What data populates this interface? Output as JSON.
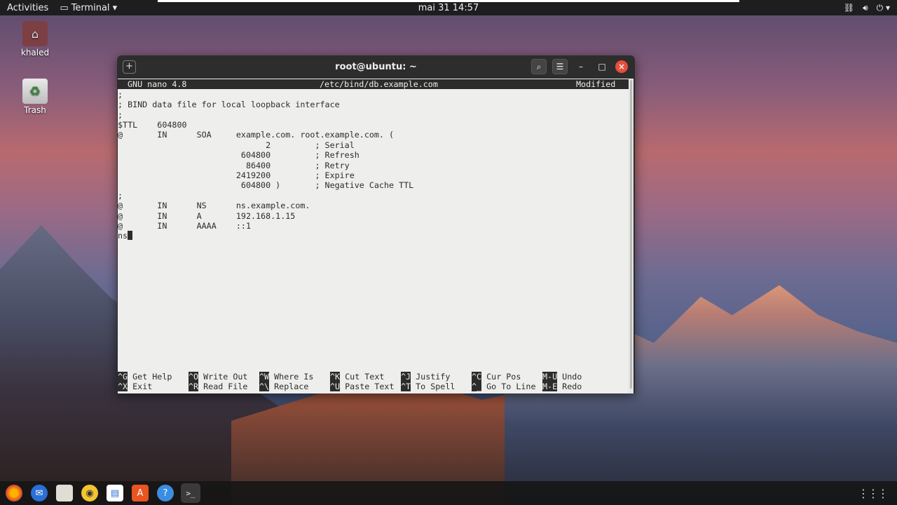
{
  "topbar": {
    "activities": "Activities",
    "app_name": "Terminal",
    "clock": "mai 31  14:57",
    "tray_icons": [
      "network-icon",
      "volume-icon",
      "power-icon"
    ]
  },
  "desktop": {
    "icons": [
      {
        "label": "khaled",
        "icon": "home-folder-icon"
      },
      {
        "label": "Trash",
        "icon": "trash-icon"
      }
    ]
  },
  "terminal": {
    "title": "root@ubuntu: ~",
    "nano": {
      "version": "GNU nano 4.8",
      "file": "/etc/bind/db.example.com",
      "status": "Modified",
      "lines": [
        ";",
        "; BIND data file for local loopback interface",
        ";",
        "$TTL    604800",
        "@       IN      SOA     example.com. root.example.com. (",
        "                              2         ; Serial",
        "                         604800         ; Refresh",
        "                          86400         ; Retry",
        "                        2419200         ; Expire",
        "                         604800 )       ; Negative Cache TTL",
        ";",
        "@       IN      NS      ns.example.com.",
        "@       IN      A       192.168.1.15",
        "@       IN      AAAA    ::1",
        "ns"
      ],
      "shortcuts_row1": [
        {
          "key": "^G",
          "label": "Get Help"
        },
        {
          "key": "^O",
          "label": "Write Out"
        },
        {
          "key": "^W",
          "label": "Where Is"
        },
        {
          "key": "^K",
          "label": "Cut Text"
        },
        {
          "key": "^J",
          "label": "Justify"
        },
        {
          "key": "^C",
          "label": "Cur Pos"
        },
        {
          "key": "M-U",
          "label": "Undo"
        }
      ],
      "shortcuts_row2": [
        {
          "key": "^X",
          "label": "Exit"
        },
        {
          "key": "^R",
          "label": "Read File"
        },
        {
          "key": "^\\",
          "label": "Replace"
        },
        {
          "key": "^U",
          "label": "Paste Text"
        },
        {
          "key": "^T",
          "label": "To Spell"
        },
        {
          "key": "^_",
          "label": "Go To Line"
        },
        {
          "key": "M-E",
          "label": "Redo"
        }
      ]
    }
  },
  "dock": {
    "items": [
      "firefox-icon",
      "thunderbird-icon",
      "files-icon",
      "rhythmbox-icon",
      "writer-icon",
      "software-icon",
      "help-icon",
      "terminal-icon"
    ],
    "show_apps": "show-applications-icon"
  },
  "colors": {
    "nano_bg": "#eeeeec",
    "nano_fg": "#2c2c2c",
    "close_button": "#e94d3b"
  }
}
